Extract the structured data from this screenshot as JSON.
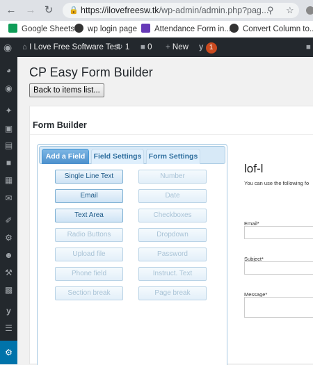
{
  "browser": {
    "url_domain": "https://ilovefreesw.tk",
    "url_path": "/wp-admin/admin.php?pag...",
    "icons": [
      "back-arrow-icon",
      "forward-arrow-icon",
      "reload-icon",
      "lock-icon",
      "zoom-icon",
      "star-icon"
    ]
  },
  "bookmarks": [
    {
      "label": "Google Sheets",
      "icon": "sheets-icon",
      "color": "#0f9d58"
    },
    {
      "label": "wp login page",
      "icon": "wordpress-icon",
      "color": "#333333"
    },
    {
      "label": "Attendance Form in...",
      "icon": "forms-icon",
      "color": "#673ab7"
    },
    {
      "label": "Convert Column to...",
      "icon": "web-icon",
      "color": "#333333"
    }
  ],
  "adminbar": {
    "site_name": "I Love Free Software Test",
    "updates_count": "1",
    "comments_count": "0",
    "new_label": "New",
    "notifications_count": "1"
  },
  "sidebar_icons": [
    "dashboard-icon",
    "jetpack-icon",
    "posts-icon",
    "media-icon",
    "pages-icon",
    "comments-icon",
    "forms-icon",
    "feedback-icon",
    "appearance-icon",
    "plugins-icon",
    "users-icon",
    "tools-icon",
    "settings-icon",
    "yoast-icon",
    "layout-icon",
    "settings-gear-icon"
  ],
  "page": {
    "title": "CP Easy Form Builder",
    "back_button": "Back to items list...",
    "panel_title": "Form Builder"
  },
  "tabs": [
    {
      "label": "Add a Field",
      "active": true
    },
    {
      "label": "Field Settings",
      "active": false
    },
    {
      "label": "Form Settings",
      "active": false
    }
  ],
  "field_buttons": [
    {
      "label": "Single Line Text",
      "enabled": true
    },
    {
      "label": "Number",
      "enabled": false
    },
    {
      "label": "Email",
      "enabled": true
    },
    {
      "label": "Date",
      "enabled": false
    },
    {
      "label": "Text Area",
      "enabled": true
    },
    {
      "label": "Checkboxes",
      "enabled": false
    },
    {
      "label": "Radio Buttons",
      "enabled": false
    },
    {
      "label": "Dropdown",
      "enabled": false
    },
    {
      "label": "Upload file",
      "enabled": false
    },
    {
      "label": "Password",
      "enabled": false
    },
    {
      "label": "Phone field",
      "enabled": false
    },
    {
      "label": "Instruct. Text",
      "enabled": false
    },
    {
      "label": "Section break",
      "enabled": false
    },
    {
      "label": "Page break",
      "enabled": false
    }
  ],
  "preview": {
    "form_name": "lof-l",
    "description": "You can use the following fo",
    "fields": [
      {
        "label": "Email*"
      },
      {
        "label": "Subject*"
      },
      {
        "label": "Message*"
      }
    ]
  }
}
